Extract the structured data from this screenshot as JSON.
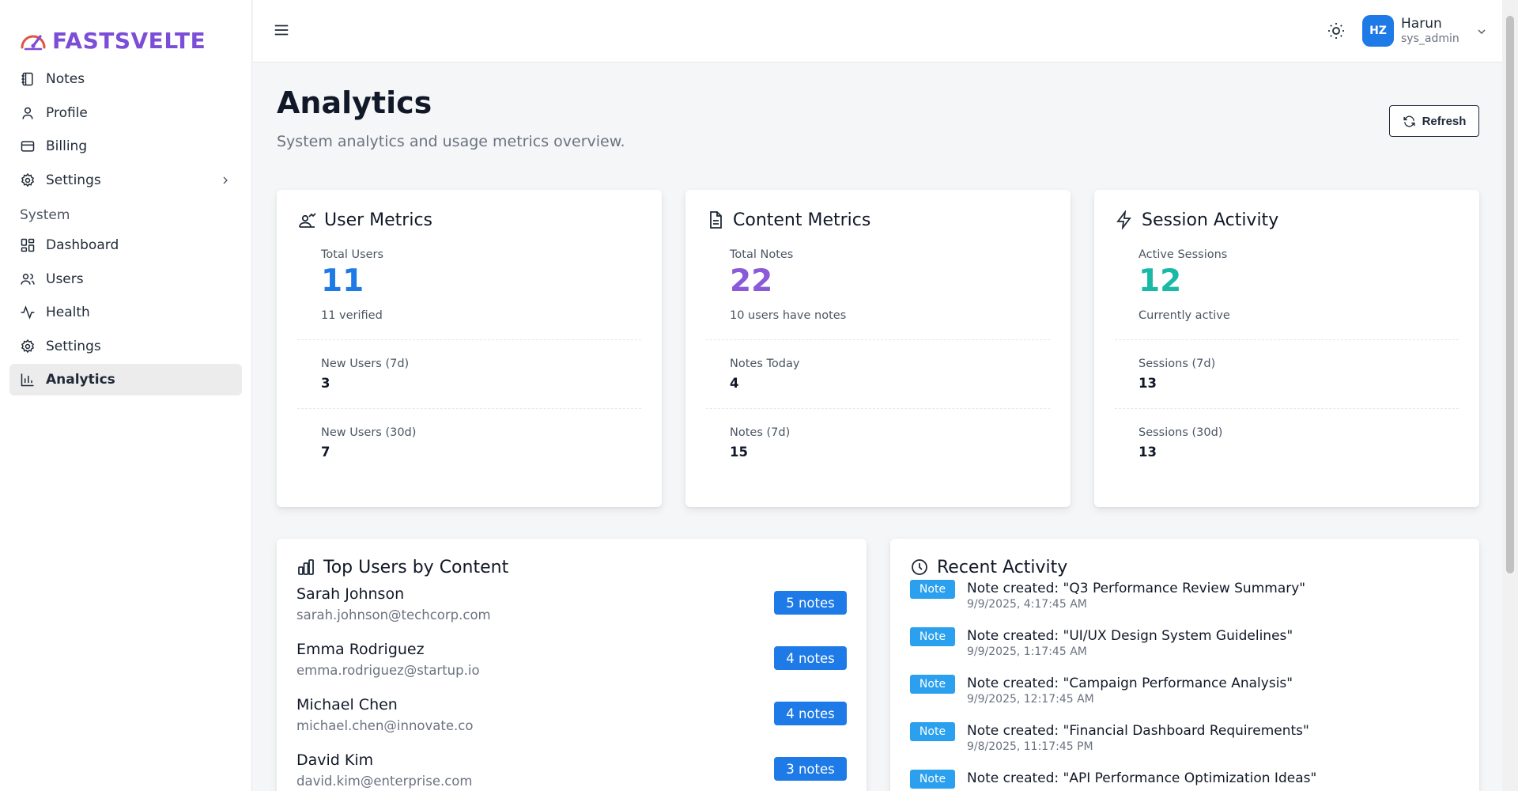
{
  "brand": {
    "name": "FASTSVELTE",
    "color": "#7c4dd6"
  },
  "sidebar": {
    "items": [
      {
        "label": "Notes",
        "icon": "notebook-icon"
      },
      {
        "label": "Profile",
        "icon": "user-icon"
      },
      {
        "label": "Billing",
        "icon": "credit-card-icon"
      },
      {
        "label": "Settings",
        "icon": "gear-icon"
      }
    ],
    "section_label": "System",
    "system_items": [
      {
        "label": "Dashboard",
        "icon": "layout-grid-icon"
      },
      {
        "label": "Users",
        "icon": "users-icon"
      },
      {
        "label": "Health",
        "icon": "activity-icon"
      },
      {
        "label": "Settings",
        "icon": "gear-icon"
      },
      {
        "label": "Analytics",
        "icon": "bar-chart-icon",
        "active": true
      }
    ]
  },
  "header": {
    "user": {
      "initials": "HZ",
      "name": "Harun",
      "role": "sys_admin"
    }
  },
  "page": {
    "title": "Analytics",
    "subtitle": "System analytics and usage metrics overview.",
    "refresh_label": "Refresh"
  },
  "metrics": {
    "users": {
      "title": "User Metrics",
      "primary_label": "Total Users",
      "primary_value": "11",
      "primary_desc": "11 verified",
      "row1_label": "New Users (7d)",
      "row1_value": "3",
      "row2_label": "New Users (30d)",
      "row2_value": "7"
    },
    "content": {
      "title": "Content Metrics",
      "primary_label": "Total Notes",
      "primary_value": "22",
      "primary_desc": "10 users have notes",
      "row1_label": "Notes Today",
      "row1_value": "4",
      "row2_label": "Notes (7d)",
      "row2_value": "15"
    },
    "sessions": {
      "title": "Session Activity",
      "primary_label": "Active Sessions",
      "primary_value": "12",
      "primary_desc": "Currently active",
      "row1_label": "Sessions (7d)",
      "row1_value": "13",
      "row2_label": "Sessions (30d)",
      "row2_value": "13"
    }
  },
  "top_users": {
    "title": "Top Users by Content",
    "rows": [
      {
        "name": "Sarah Johnson",
        "email": "sarah.johnson@techcorp.com",
        "badge": "5 notes"
      },
      {
        "name": "Emma Rodriguez",
        "email": "emma.rodriguez@startup.io",
        "badge": "4 notes"
      },
      {
        "name": "Michael Chen",
        "email": "michael.chen@innovate.co",
        "badge": "4 notes"
      },
      {
        "name": "David Kim",
        "email": "david.kim@enterprise.com",
        "badge": "3 notes"
      }
    ]
  },
  "recent_activity": {
    "title": "Recent Activity",
    "badge_label": "Note",
    "rows": [
      {
        "text": "Note created: \"Q3 Performance Review Summary\"",
        "time": "9/9/2025, 4:17:45 AM"
      },
      {
        "text": "Note created: \"UI/UX Design System Guidelines\"",
        "time": "9/9/2025, 1:17:45 AM"
      },
      {
        "text": "Note created: \"Campaign Performance Analysis\"",
        "time": "9/9/2025, 12:17:45 AM"
      },
      {
        "text": "Note created: \"Financial Dashboard Requirements\"",
        "time": "9/8/2025, 11:17:45 PM"
      },
      {
        "text": "Note created: \"API Performance Optimization Ideas\"",
        "time": ""
      }
    ]
  },
  "colors": {
    "accent_blue": "#1e7ae6",
    "accent_purple": "#8a5ad8",
    "accent_teal": "#19b9a7",
    "badge_blue": "#2ba0ee"
  }
}
